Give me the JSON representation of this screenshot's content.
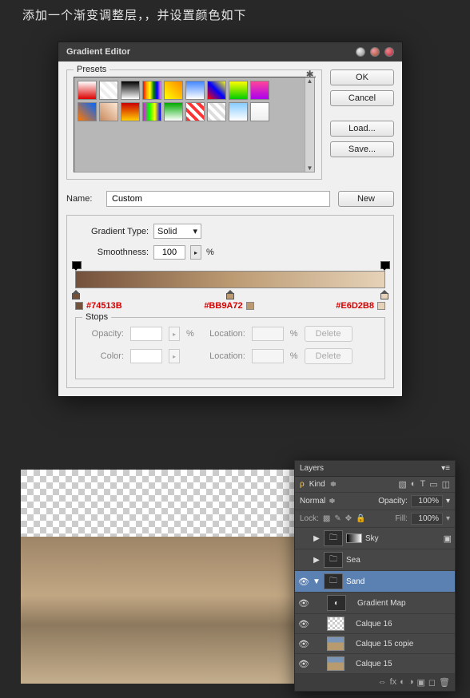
{
  "caption": "添加一个渐变调整层，，并设置颜色如下",
  "dialog": {
    "title": "Gradient Editor",
    "presets_label": "Presets",
    "buttons": {
      "ok": "OK",
      "cancel": "Cancel",
      "load": "Load...",
      "save": "Save...",
      "new": "New",
      "delete": "Delete"
    },
    "name_label": "Name:",
    "name_value": "Custom",
    "grad_type_label": "Gradient Type:",
    "grad_type_value": "Solid",
    "smoothness_label": "Smoothness:",
    "smoothness_value": "100",
    "percent": "%",
    "stops_label": "Stops",
    "opacity_label": "Opacity:",
    "location_label": "Location:",
    "color_label": "Color:",
    "codes": {
      "c1": "#74513B",
      "c2": "#BB9A72",
      "c3": "#E6D2B8"
    }
  },
  "presets": [
    [
      "linear-gradient(#fff,#d00)",
      "repeating-linear-gradient(45deg,#eee,#eee 4px,#fff 4px,#fff 8px)",
      "linear-gradient(#000,#fff)",
      "linear-gradient(90deg,red,orange,yellow,green,blue,violet)",
      "linear-gradient(45deg,#ff0,#f80)",
      "linear-gradient(#48f,#fff)",
      "linear-gradient(45deg,#f00,#00f,#ff0)",
      "linear-gradient(#ff0,#0c0)",
      "linear-gradient(#f49,#a0e)"
    ],
    [
      "linear-gradient(45deg,#f70,#06f)",
      "linear-gradient(45deg,#c98a5e,#fce9d6)",
      "linear-gradient(#c00,#fc0)",
      "linear-gradient(90deg,#f0f,#0f0,#ff0,#00f)",
      "linear-gradient(#0a0,#fff)",
      "repeating-linear-gradient(45deg,#f33,#f33 4px,#fff 4px,#fff 8px)",
      "repeating-linear-gradient(45deg,#ddd,#ddd 4px,#fff 4px,#fff 8px)",
      "linear-gradient(#8cf,#fff)",
      "linear-gradient(#fff,#eee)"
    ]
  ],
  "layers": {
    "title": "Layers",
    "kind_label": "Kind",
    "blend_mode": "Normal",
    "opacity_label": "Opacity:",
    "opacity_value": "100%",
    "lock_label": "Lock:",
    "fill_label": "Fill:",
    "fill_value": "100%",
    "items": [
      {
        "name": "Sky",
        "type": "folder",
        "visible": false,
        "open": false,
        "selected": false
      },
      {
        "name": "Sea",
        "type": "folder",
        "visible": false,
        "open": false,
        "selected": false
      },
      {
        "name": "Sand",
        "type": "folder",
        "visible": true,
        "open": true,
        "selected": true
      },
      {
        "name": "Gradient Map",
        "type": "adj",
        "visible": true,
        "indent": 1
      },
      {
        "name": "Calque 16",
        "type": "layer",
        "visible": true,
        "thumb": "check",
        "indent": 1
      },
      {
        "name": "Calque 15 copie",
        "type": "layer",
        "visible": true,
        "thumb": "photo",
        "indent": 1
      },
      {
        "name": "Calque 15",
        "type": "layer",
        "visible": true,
        "thumb": "photo",
        "indent": 1
      }
    ]
  }
}
